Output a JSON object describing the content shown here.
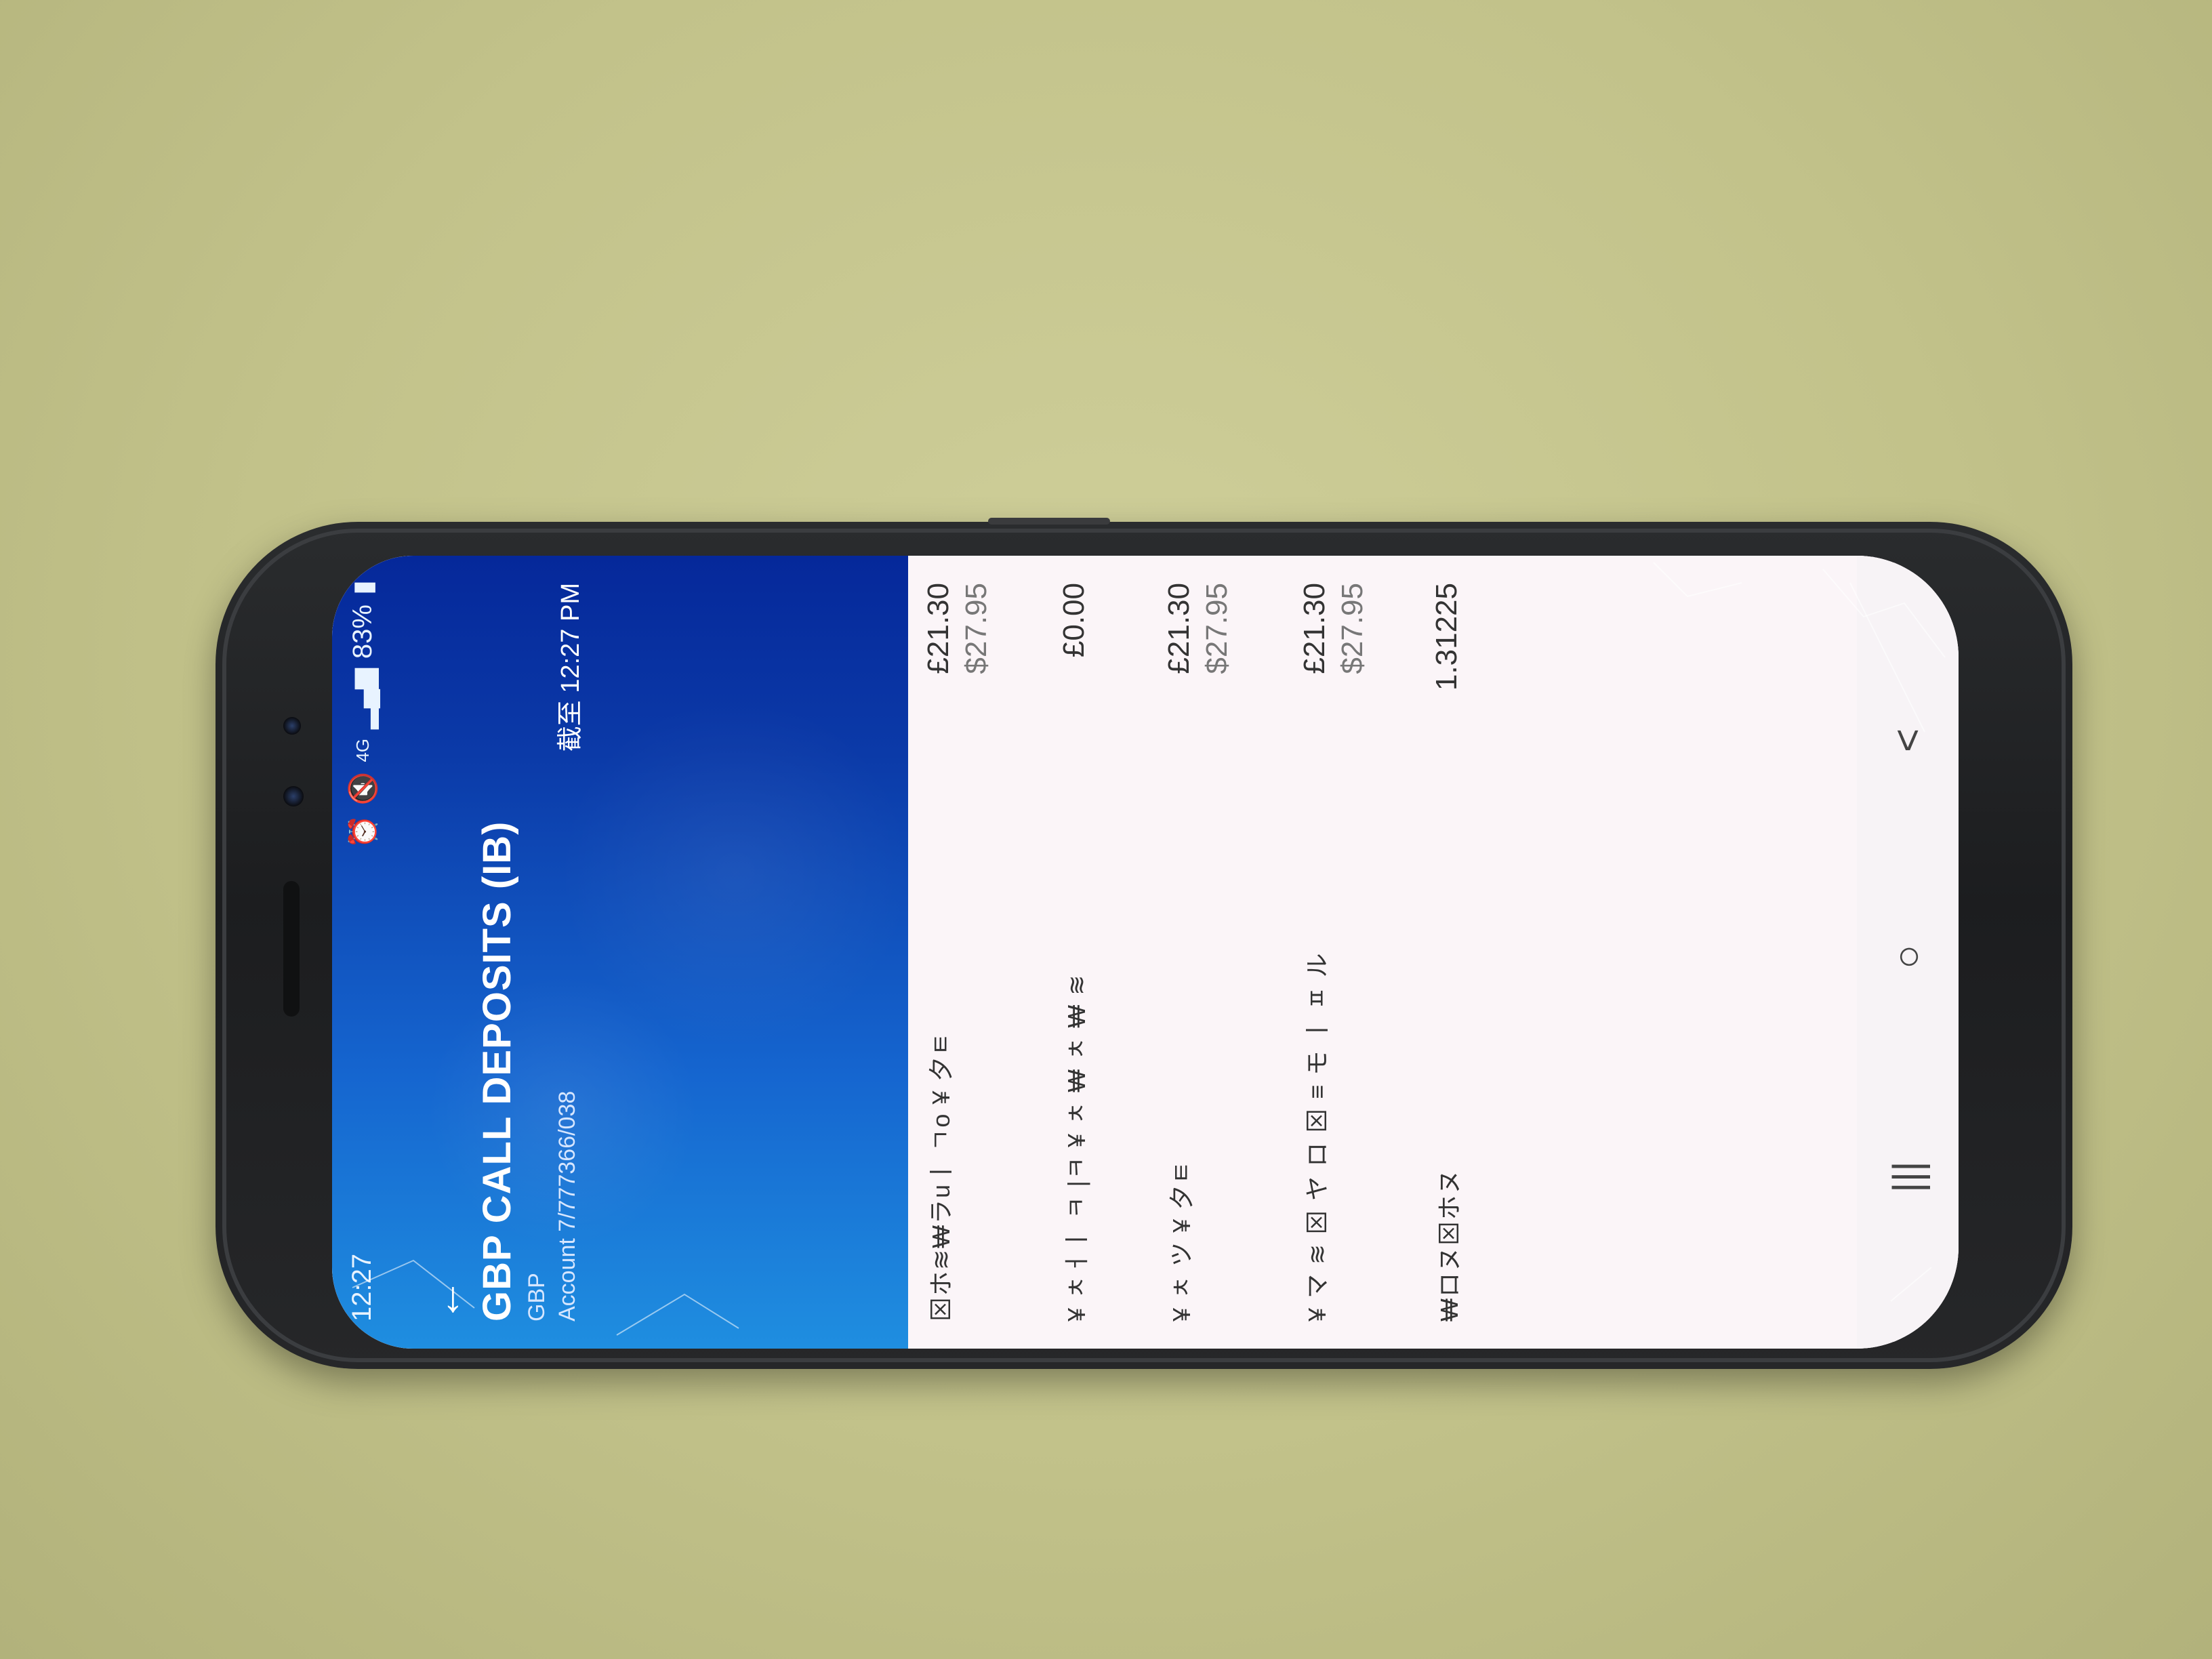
{
  "status_bar": {
    "time": "12:27",
    "network": "4G",
    "battery": "83%"
  },
  "app_bar": {
    "back_icon": "arrow-left-icon"
  },
  "account": {
    "title": "GBP CALL DEPOSITS (IB)",
    "currency": "GBP",
    "account_number": "Account 7/777366/038",
    "as_of": "截至 12:27 PM"
  },
  "rows": [
    {
      "label": "⊠ホ≋₩ラuㅣ ㄱo ¥ 夕ㅌ",
      "primary": "£21.30",
      "secondary": "$27.95"
    },
    {
      "label": "¥ ㅊㅓㅣ ㅋ |ㅋ ¥ ㅊ ₩ ㅊ ₩ ≋",
      "primary": "£0.00",
      "secondary": ""
    },
    {
      "label": "¥ ㅊ ツ ¥ 夕ㅌ",
      "primary": "£21.30",
      "secondary": "$27.95"
    },
    {
      "label": "¥ マ ≋ ⊠ ヤ ロ ⊠ ≡ モ ㅣ ㅍ ル",
      "primary": "£21.30",
      "secondary": "$27.95"
    },
    {
      "label": "₩ロヌ⊠ホヌ",
      "primary": "1.31225",
      "secondary": ""
    }
  ],
  "nav": {
    "recents": "|||",
    "home": "○",
    "back": "<"
  },
  "colors": {
    "header_start": "#1f8ee0",
    "header_end": "#05289a",
    "background": "#fbf5f8"
  }
}
